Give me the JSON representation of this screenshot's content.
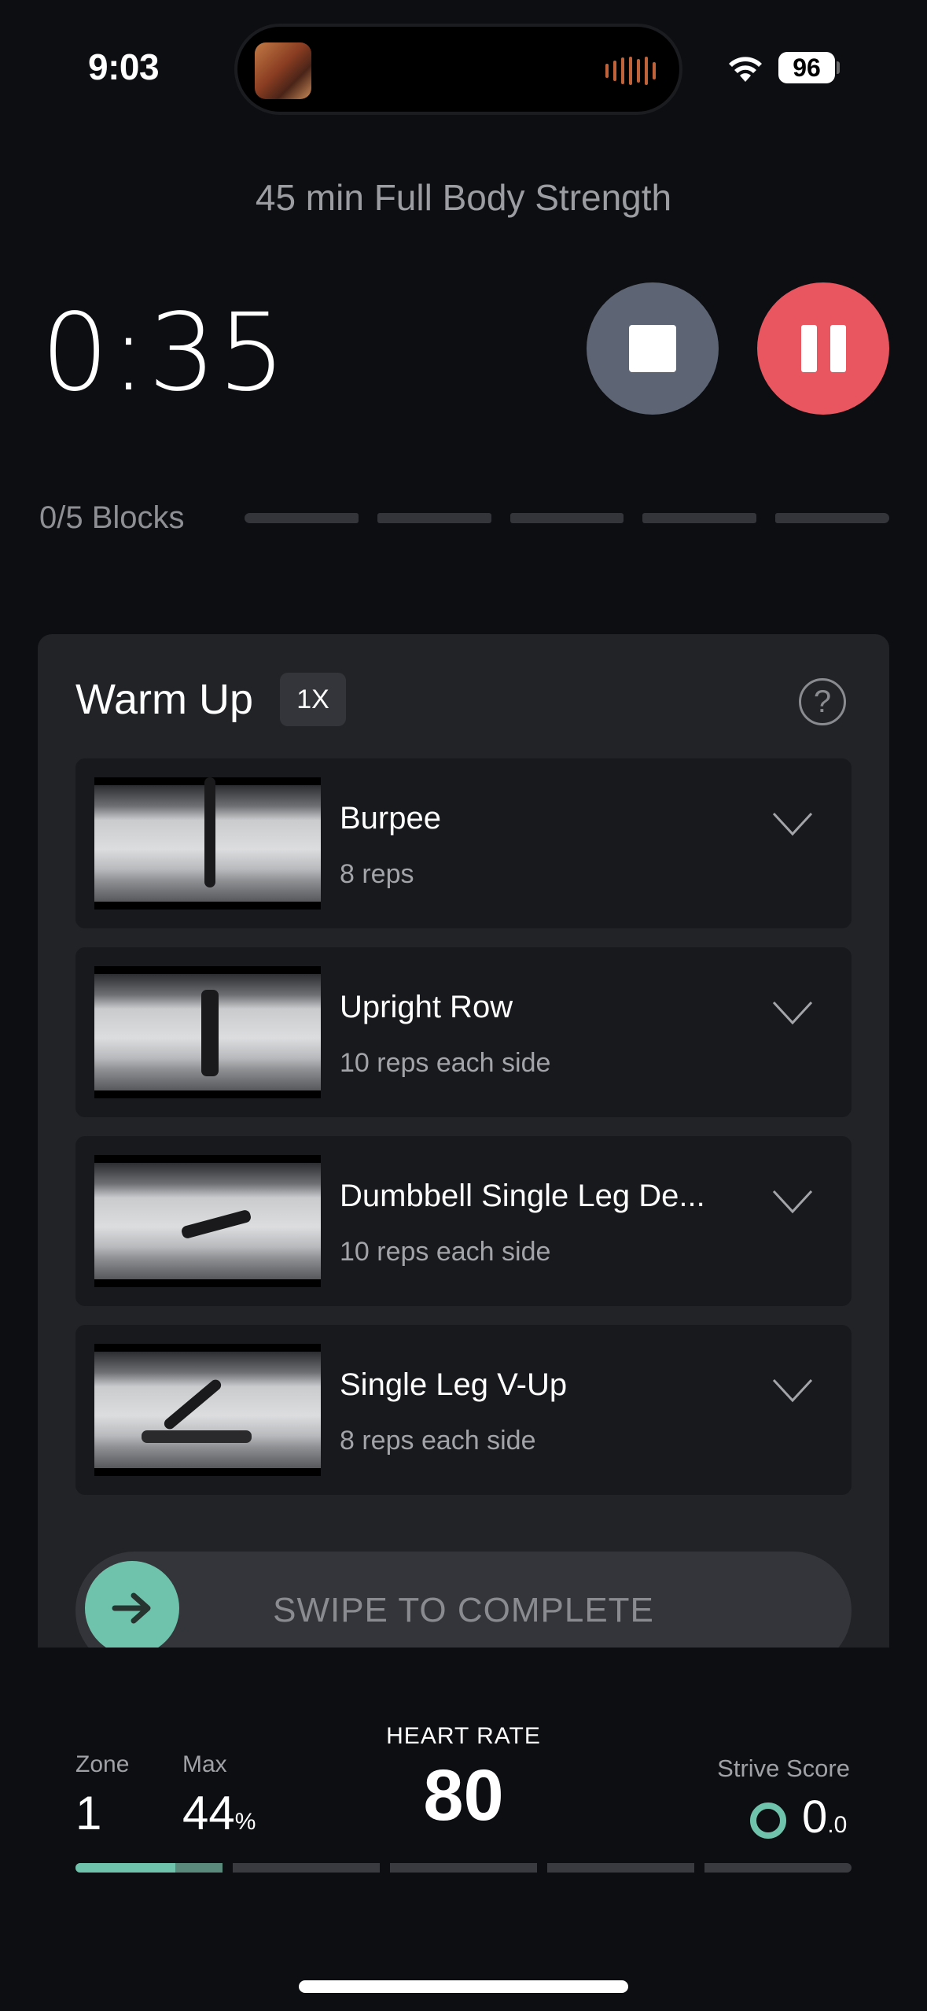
{
  "status_bar": {
    "time": "9:03",
    "battery": "96",
    "wifi_icon": "wifi-icon",
    "now_playing_icon": "audio-waveform-icon"
  },
  "header": {
    "workout_title": "45 min Full Body Strength",
    "timer": "0:35",
    "stop_icon": "stop-icon",
    "pause_icon": "pause-icon"
  },
  "blocks": {
    "label": "0/5 Blocks",
    "completed": 0,
    "total": 5
  },
  "block": {
    "title": "Warm Up",
    "badge": "1X",
    "help": "?",
    "exercises": [
      {
        "name": "Burpee",
        "reps": "8 reps"
      },
      {
        "name": "Upright Row",
        "reps": "10 reps each side"
      },
      {
        "name": "Dumbbell Single Leg De...",
        "reps": "10 reps each side"
      },
      {
        "name": "Single Leg V-Up",
        "reps": "8 reps each side"
      }
    ]
  },
  "swipe": {
    "label": "SWIPE TO COMPLETE"
  },
  "heart_rate": {
    "label": "HEART RATE",
    "value": "80",
    "zone_label": "Zone",
    "zone_value": "1",
    "max_label": "Max",
    "max_value": "44",
    "max_unit": "%",
    "strive_label": "Strive Score",
    "strive_int": "0",
    "strive_dec": ".0",
    "zone_segments": 5,
    "zone1_progress_fraction": 0.68,
    "zone1_secondary_fraction": 1.0
  },
  "colors": {
    "accent_teal": "#6fc3ac",
    "pause_red": "#e95660",
    "stop_gray": "#5d6473",
    "background": "#0d0e12",
    "card": "#212327"
  }
}
